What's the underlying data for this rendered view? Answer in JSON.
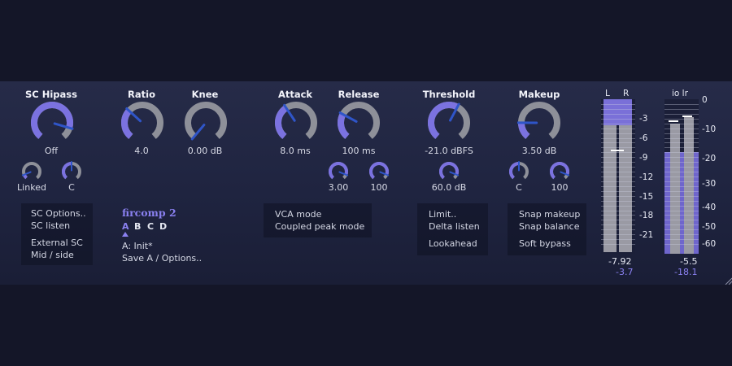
{
  "labels": {
    "sc_hipass": "SC Hipass",
    "ratio": "Ratio",
    "knee": "Knee",
    "attack": "Attack",
    "release": "Release",
    "threshold": "Threshold",
    "makeup": "Makeup"
  },
  "knobs": [
    {
      "id": "sc-hipass-knob",
      "value": "Off",
      "level": 0.88,
      "size": "large"
    },
    {
      "id": "ratio-knob",
      "value": "4.0",
      "level": 0.33,
      "size": "large"
    },
    {
      "id": "knee-knob",
      "value": "0.00 dB",
      "level": 0.0,
      "size": "large"
    },
    {
      "id": "attack-knob",
      "value": "8.0 ms",
      "level": 0.38,
      "size": "large"
    },
    {
      "id": "release-knob",
      "value": "100 ms",
      "level": 0.28,
      "size": "large"
    },
    {
      "id": "threshold-knob",
      "value": "-21.0 dBFS",
      "level": 0.6,
      "size": "large"
    },
    {
      "id": "makeup-knob",
      "value": "3.50 dB",
      "level": 0.18,
      "size": "large"
    },
    {
      "id": "sc-linked-knob",
      "value": "Linked",
      "level": 0.1,
      "size": "small"
    },
    {
      "id": "sc-channel-knob",
      "value": "C",
      "level": 0.5,
      "size": "small"
    },
    {
      "id": "release-sub1-knob",
      "value": "3.00",
      "level": 0.9,
      "size": "small"
    },
    {
      "id": "release-sub2-knob",
      "value": "100",
      "level": 0.9,
      "size": "small"
    },
    {
      "id": "lookahead-knob",
      "value": "60.0 dB",
      "level": 0.9,
      "size": "small"
    },
    {
      "id": "makeup-channel-knob",
      "value": "C",
      "level": 0.5,
      "size": "small"
    },
    {
      "id": "makeup-sub-knob",
      "value": "100",
      "level": 0.9,
      "size": "small"
    }
  ],
  "sc_box": {
    "options": "SC Options..",
    "listen": "SC listen",
    "external": "External SC",
    "midside": "Mid / side"
  },
  "preset": {
    "title": "fircomp 2",
    "slots": [
      "A",
      "B",
      "C",
      "D"
    ],
    "current": "A: Init*",
    "save": "Save A / Options.."
  },
  "mode_box": {
    "vca": "VCA mode",
    "coupled": "Coupled peak mode"
  },
  "limit_box": {
    "limit": "Limit..",
    "delta": "Delta listen",
    "lookahead": "Lookahead"
  },
  "snap_box": {
    "snap_makeup": "Snap makeup",
    "snap_balance": "Snap balance",
    "soft_bypass": "Soft bypass"
  },
  "meter_in": {
    "l_label": "L",
    "r_label": "R",
    "scale": [
      "-3",
      "-6",
      "-9",
      "-12",
      "-15",
      "-18",
      "-21"
    ],
    "peak": "-7.92",
    "reduction": "-3.7"
  },
  "meter_out": {
    "label": "io lr",
    "scale": [
      "0",
      "-10",
      "-20",
      "-30",
      "-40",
      "-50",
      "-60"
    ],
    "peak": "-5.5",
    "reduction": "-18.1"
  },
  "colors": {
    "accent": "#7b72e0",
    "panel": "#232845",
    "arc": "#8e9099",
    "pointer": "#2f55c8"
  }
}
